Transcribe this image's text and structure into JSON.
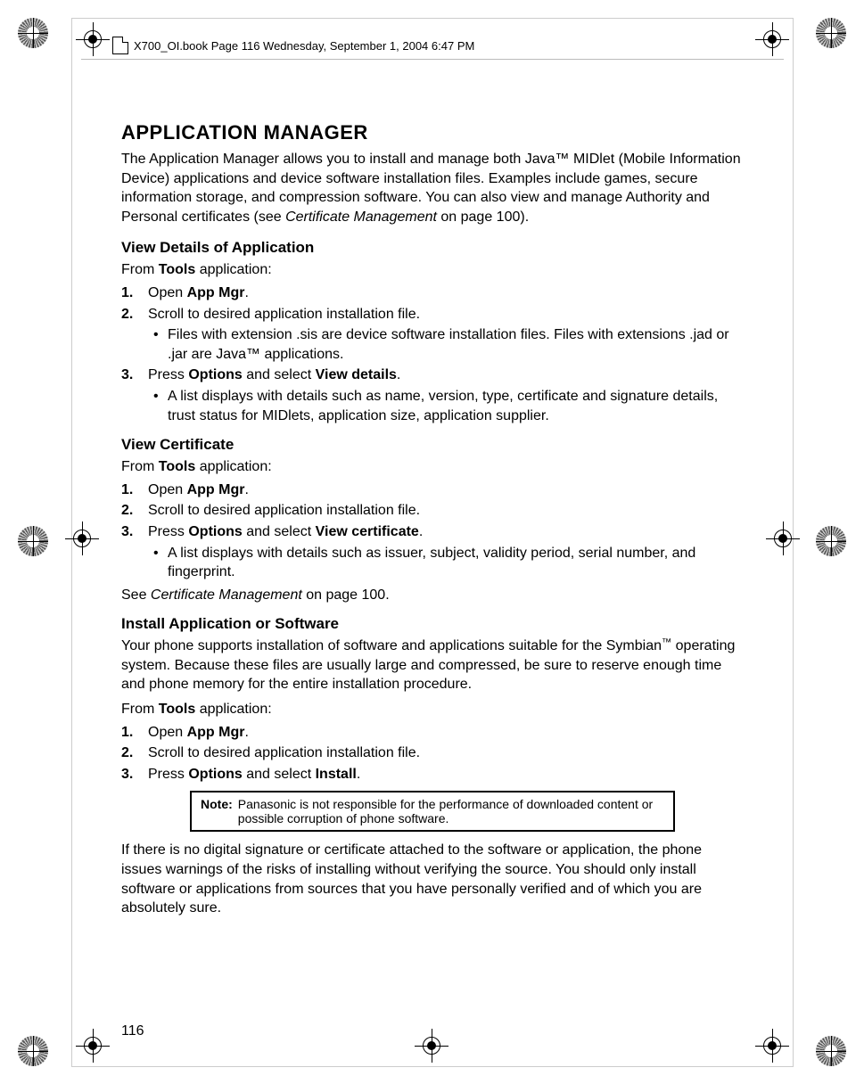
{
  "running_head": "X700_OI.book  Page 116  Wednesday, September 1, 2004  6:47 PM",
  "page_number": "116",
  "title": "APPLICATION MANAGER",
  "intro_1": "The Application Manager allows you to install and manage both Java™ MIDlet (Mobile Information Device) applications and device software installation files. Examples include games, secure information storage, and compression software. You can also view and manage Authority and Personal certificates (see ",
  "intro_ref": "Certificate Management",
  "intro_2": " on page 100).",
  "sec1": {
    "heading": "View Details of Application",
    "from_label": "From ",
    "from_bold": "Tools",
    "from_tail": " application:",
    "s1_pre": "Open ",
    "s1_bold": "App Mgr",
    "s1_post": ".",
    "s2": "Scroll to desired application installation file.",
    "s2_sub": "Files with extension .sis are device software installation files. Files with extensions .jad or .jar are Java™ applications.",
    "s3_pre": "Press ",
    "s3_b1": "Options",
    "s3_mid": " and select ",
    "s3_b2": "View details",
    "s3_post": ".",
    "s3_sub": "A list displays with details such as name, version, type, certificate and signature details, trust status for MIDlets, application size, application supplier."
  },
  "sec2": {
    "heading": "View Certificate",
    "from_label": "From ",
    "from_bold": "Tools",
    "from_tail": " application:",
    "s1_pre": "Open ",
    "s1_bold": "App Mgr",
    "s1_post": ".",
    "s2": "Scroll to desired application installation file.",
    "s3_pre": "Press ",
    "s3_b1": "Options",
    "s3_mid": " and select ",
    "s3_b2": "View certificate",
    "s3_post": ".",
    "s3_sub": "A list displays with details such as issuer, subject, validity period, serial number, and fingerprint.",
    "see_pre": "See ",
    "see_ref": "Certificate Management",
    "see_post": " on page 100."
  },
  "sec3": {
    "heading": "Install Application or Software",
    "p1_a": "Your phone supports installation of software and applications suitable for the Symbian",
    "p1_b": " operating system. Because these files are usually large and compressed, be sure to reserve enough time and phone memory for the entire installation procedure.",
    "from_label": "From ",
    "from_bold": "Tools",
    "from_tail": " application:",
    "s1_pre": "Open ",
    "s1_bold": "App Mgr",
    "s1_post": ".",
    "s2": "Scroll to desired application installation file.",
    "s3_pre": "Press ",
    "s3_b1": "Options",
    "s3_mid": " and select ",
    "s3_b2": "Install",
    "s3_post": ".",
    "note_label": "Note",
    "note_body": "Panasonic is not responsible for the performance of downloaded content or possible corruption of phone software.",
    "closing": "If there is no digital signature or certificate attached to the software or application, the phone issues warnings of the risks of installing without verifying the source. You should only install software or applications from sources that you have personally verified and of which you are absolutely sure."
  },
  "nums": {
    "n1": "1.",
    "n2": "2.",
    "n3": "3."
  },
  "tm": "™",
  "colon": ":"
}
